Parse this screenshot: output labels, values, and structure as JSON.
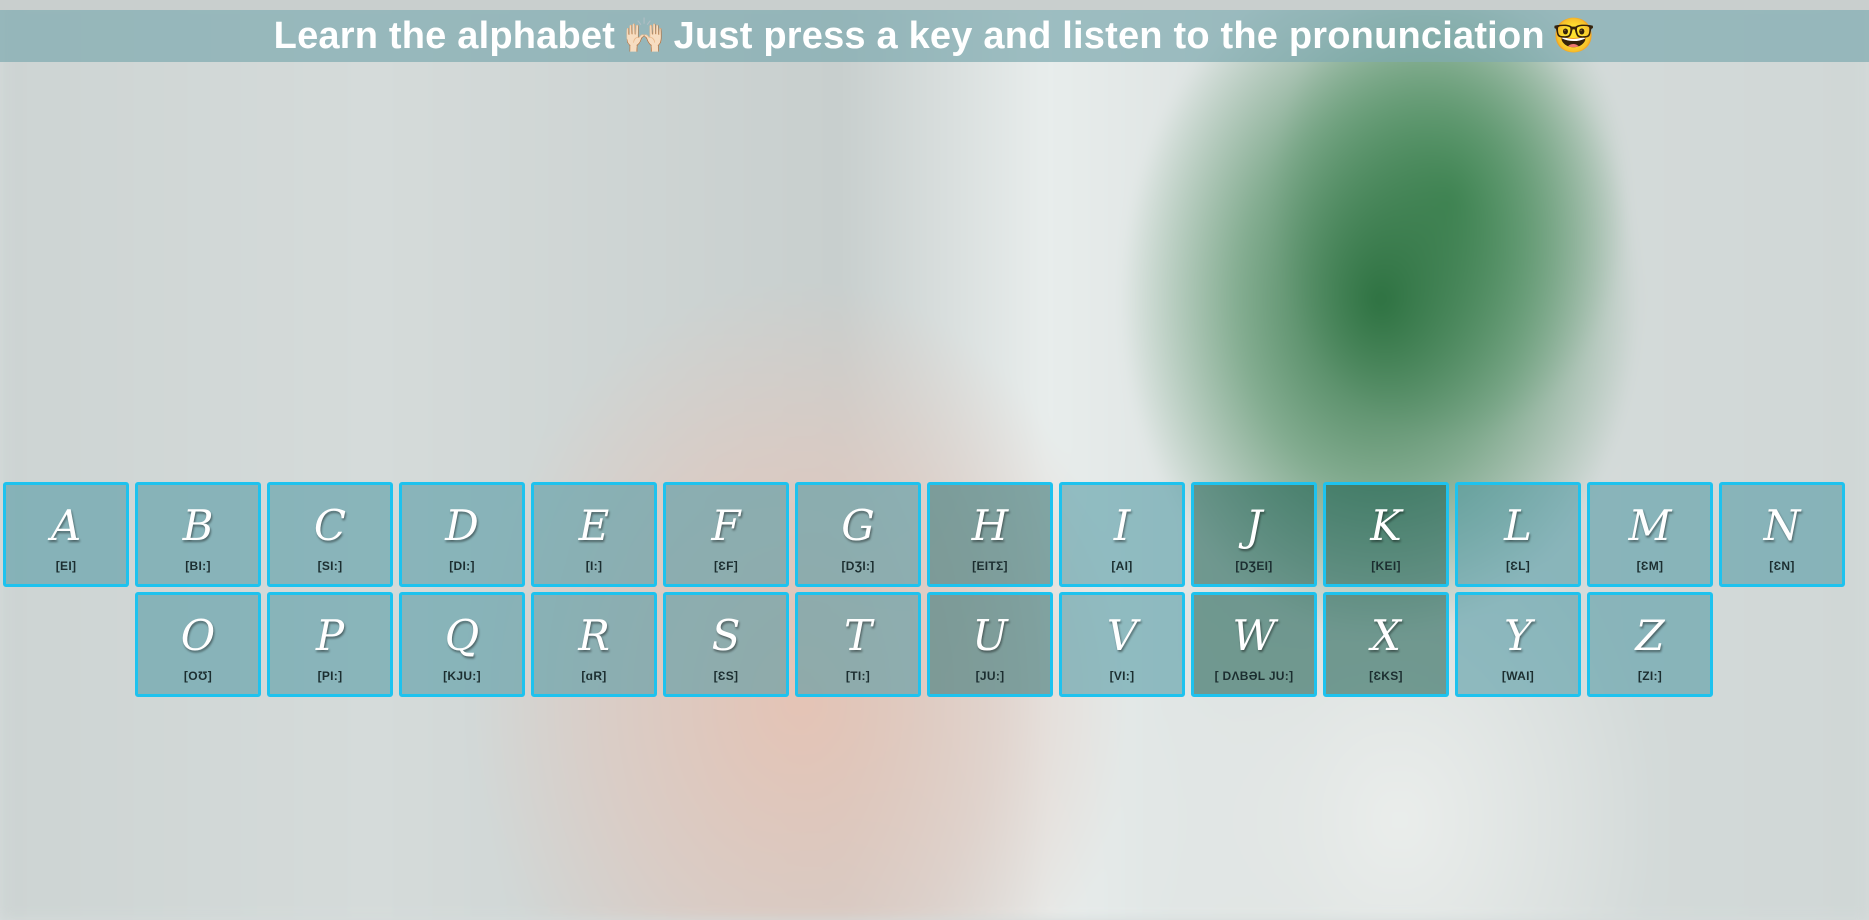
{
  "header": {
    "title_part1": "Learn the alphabet",
    "emoji1": "🙌🏻",
    "title_part2": "Just press a key and listen to the pronunciation",
    "emoji2": "🤓"
  },
  "keys_row1": [
    {
      "letter": "A",
      "ipa": "[EI]"
    },
    {
      "letter": "B",
      "ipa": "[BI:]"
    },
    {
      "letter": "C",
      "ipa": "[SI:]"
    },
    {
      "letter": "D",
      "ipa": "[DI:]"
    },
    {
      "letter": "E",
      "ipa": "[I:]"
    },
    {
      "letter": "F",
      "ipa": "[ƐF]"
    },
    {
      "letter": "G",
      "ipa": "[DƷI:]"
    },
    {
      "letter": "H",
      "ipa": "[EITΣ]"
    },
    {
      "letter": "I",
      "ipa": "[AI]"
    },
    {
      "letter": "J",
      "ipa": "[DƷEI]"
    },
    {
      "letter": "K",
      "ipa": "[KEI]"
    },
    {
      "letter": "L",
      "ipa": "[ƐL]"
    },
    {
      "letter": "M",
      "ipa": "[ƐM]"
    },
    {
      "letter": "N",
      "ipa": "[ƐN]"
    }
  ],
  "keys_row2": [
    {
      "letter": "O",
      "ipa": "[OƱ]"
    },
    {
      "letter": "P",
      "ipa": "[PI:]"
    },
    {
      "letter": "Q",
      "ipa": "[KJU:]"
    },
    {
      "letter": "R",
      "ipa": "[ɑR]"
    },
    {
      "letter": "S",
      "ipa": "[ƐS]"
    },
    {
      "letter": "T",
      "ipa": "[TI:]"
    },
    {
      "letter": "U",
      "ipa": "[JU:]"
    },
    {
      "letter": "V",
      "ipa": "[VI:]"
    },
    {
      "letter": "W",
      "ipa": "[ DΛBƏL JU:]"
    },
    {
      "letter": "X",
      "ipa": "[ƐKS]"
    },
    {
      "letter": "Y",
      "ipa": "[WAI]"
    },
    {
      "letter": "Z",
      "ipa": "[ZI:]"
    }
  ],
  "colors": {
    "key_border": "#1ec2ee",
    "header_bg": "#7faab0"
  }
}
